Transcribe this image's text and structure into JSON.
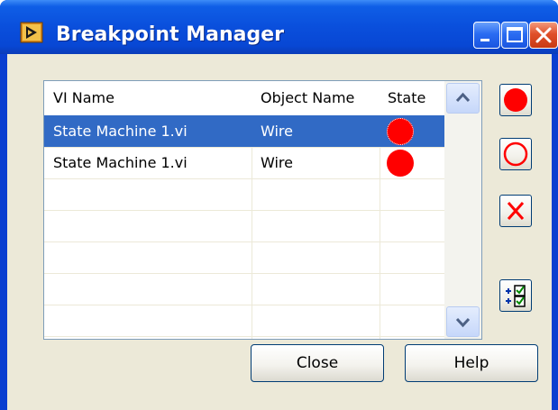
{
  "window": {
    "title": "Breakpoint Manager",
    "titlebar_buttons": [
      "minimize",
      "maximize",
      "close"
    ]
  },
  "table": {
    "columns": [
      "VI Name",
      "Object Name",
      "State"
    ],
    "rows": [
      {
        "vi_name": "State Machine 1.vi",
        "object_name": "Wire",
        "state": "enabled",
        "selected": true
      },
      {
        "vi_name": "State Machine 1.vi",
        "object_name": "Wire",
        "state": "enabled",
        "selected": false
      }
    ],
    "empty_rows": 4
  },
  "side_buttons": [
    {
      "name": "enable-breakpoint-button",
      "icon": "filled-red-circle-icon"
    },
    {
      "name": "disable-breakpoint-button",
      "icon": "hollow-red-circle-icon"
    },
    {
      "name": "clear-breakpoint-button",
      "icon": "red-x-icon"
    },
    {
      "name": "show-options-button",
      "icon": "add-checkbox-icon"
    }
  ],
  "buttons": {
    "close_label": "Close",
    "help_label": "Help"
  },
  "colors": {
    "titlebar": "#0a4fdc",
    "selection": "#316ac5",
    "breakpoint": "#ff0000",
    "dialog_bg": "#ece9d8"
  }
}
